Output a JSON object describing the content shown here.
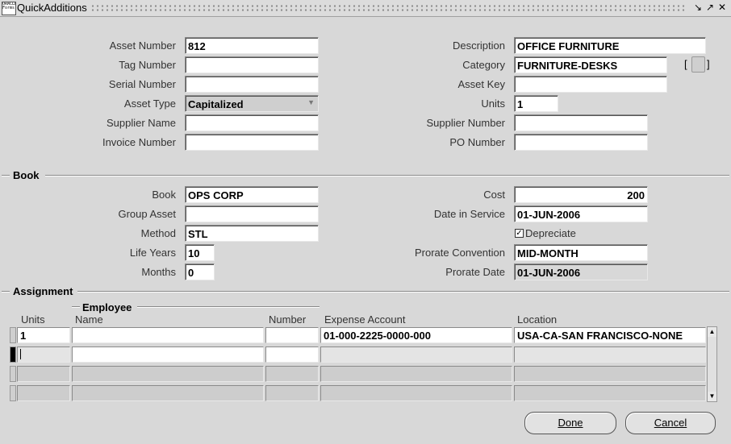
{
  "window": {
    "title": "QuickAdditions",
    "app_icon_text": "ORACLE Forms"
  },
  "header_fields": {
    "asset_number": {
      "label": "Asset Number",
      "value": "812"
    },
    "tag_number": {
      "label": "Tag Number",
      "value": ""
    },
    "serial_number": {
      "label": "Serial Number",
      "value": ""
    },
    "asset_type": {
      "label": "Asset Type",
      "value": "Capitalized"
    },
    "supplier_name": {
      "label": "Supplier Name",
      "value": ""
    },
    "invoice_number": {
      "label": "Invoice Number",
      "value": ""
    },
    "description": {
      "label": "Description",
      "value": "OFFICE FURNITURE"
    },
    "category": {
      "label": "Category",
      "value": "FURNITURE-DESKS"
    },
    "asset_key": {
      "label": "Asset Key",
      "value": ""
    },
    "units": {
      "label": "Units",
      "value": "1"
    },
    "supplier_number": {
      "label": "Supplier Number",
      "value": ""
    },
    "po_number": {
      "label": "PO Number",
      "value": ""
    }
  },
  "book_section": {
    "title": "Book",
    "book": {
      "label": "Book",
      "value": "OPS CORP"
    },
    "group_asset": {
      "label": "Group Asset",
      "value": ""
    },
    "method": {
      "label": "Method",
      "value": "STL"
    },
    "life_years": {
      "label": "Life Years",
      "value": "10"
    },
    "months": {
      "label": "Months",
      "value": "0"
    },
    "cost": {
      "label": "Cost",
      "value": "200"
    },
    "date_in_service": {
      "label": "Date in Service",
      "value": "01-JUN-2006"
    },
    "depreciate": {
      "label": "Depreciate",
      "checked": true
    },
    "prorate_convention": {
      "label": "Prorate Convention",
      "value": "MID-MONTH"
    },
    "prorate_date": {
      "label": "Prorate Date",
      "value": "01-JUN-2006"
    }
  },
  "assignment_section": {
    "title": "Assignment",
    "headers": {
      "units": "Units",
      "employee_group": "Employee",
      "name": "Name",
      "number": "Number",
      "expense_account": "Expense Account",
      "location": "Location"
    },
    "rows": [
      {
        "units": "1",
        "name": "",
        "number": "",
        "expense_account": "01-000-2225-0000-000",
        "location": "USA-CA-SAN FRANCISCO-NONE"
      },
      {
        "units": "",
        "name": "",
        "number": "",
        "expense_account": "",
        "location": ""
      },
      {
        "units": "",
        "name": "",
        "number": "",
        "expense_account": "",
        "location": ""
      },
      {
        "units": "",
        "name": "",
        "number": "",
        "expense_account": "",
        "location": ""
      }
    ]
  },
  "buttons": {
    "done": "Done",
    "cancel": "Cancel"
  }
}
